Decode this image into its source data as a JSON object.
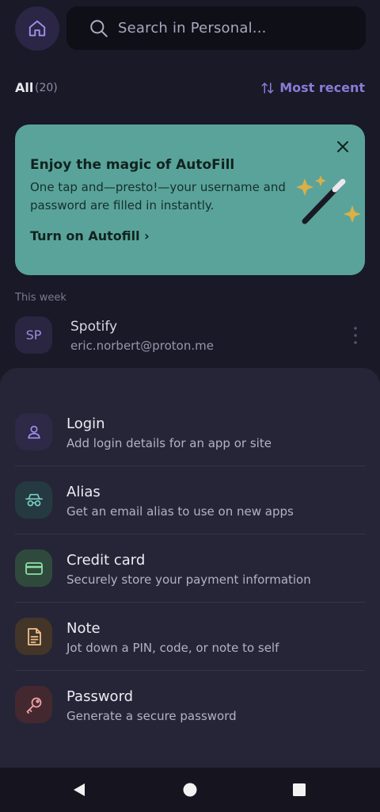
{
  "search": {
    "placeholder": "Search in Personal..."
  },
  "filter": {
    "all_label": "All",
    "count": "(20)",
    "sort_label": "Most recent"
  },
  "banner": {
    "title": "Enjoy the magic of AutoFill",
    "body": "One tap and—presto!—your username and password are filled in instantly.",
    "cta": "Turn on Autofill ›"
  },
  "list": {
    "section": "This week",
    "items": [
      {
        "initials": "SP",
        "title": "Spotify",
        "subtitle": "eric.norbert@proton.me"
      }
    ]
  },
  "sheet": {
    "options": [
      {
        "title": "Login",
        "subtitle": "Add login details for an app or site",
        "icon": "user-icon",
        "color": "#2d2946",
        "accent": "#a48ff0"
      },
      {
        "title": "Alias",
        "subtitle": "Get an email alias to use on new apps",
        "icon": "alias-mask-icon",
        "color": "#253a40",
        "accent": "#79cfc4"
      },
      {
        "title": "Credit card",
        "subtitle": "Securely store your payment information",
        "icon": "credit-card-icon",
        "color": "#2f4a3c",
        "accent": "#8fe0a6"
      },
      {
        "title": "Note",
        "subtitle": "Jot down a PIN, code, or note to self",
        "icon": "note-icon",
        "color": "#433528",
        "accent": "#f0c08a"
      },
      {
        "title": "Password",
        "subtitle": "Generate a secure password",
        "icon": "key-icon",
        "color": "#43292f",
        "accent": "#f0a0a8"
      }
    ]
  },
  "colors": {
    "background": "#191927",
    "accent": "#8b7ad8",
    "banner": "#5aa39a",
    "sheet": "#262538"
  }
}
